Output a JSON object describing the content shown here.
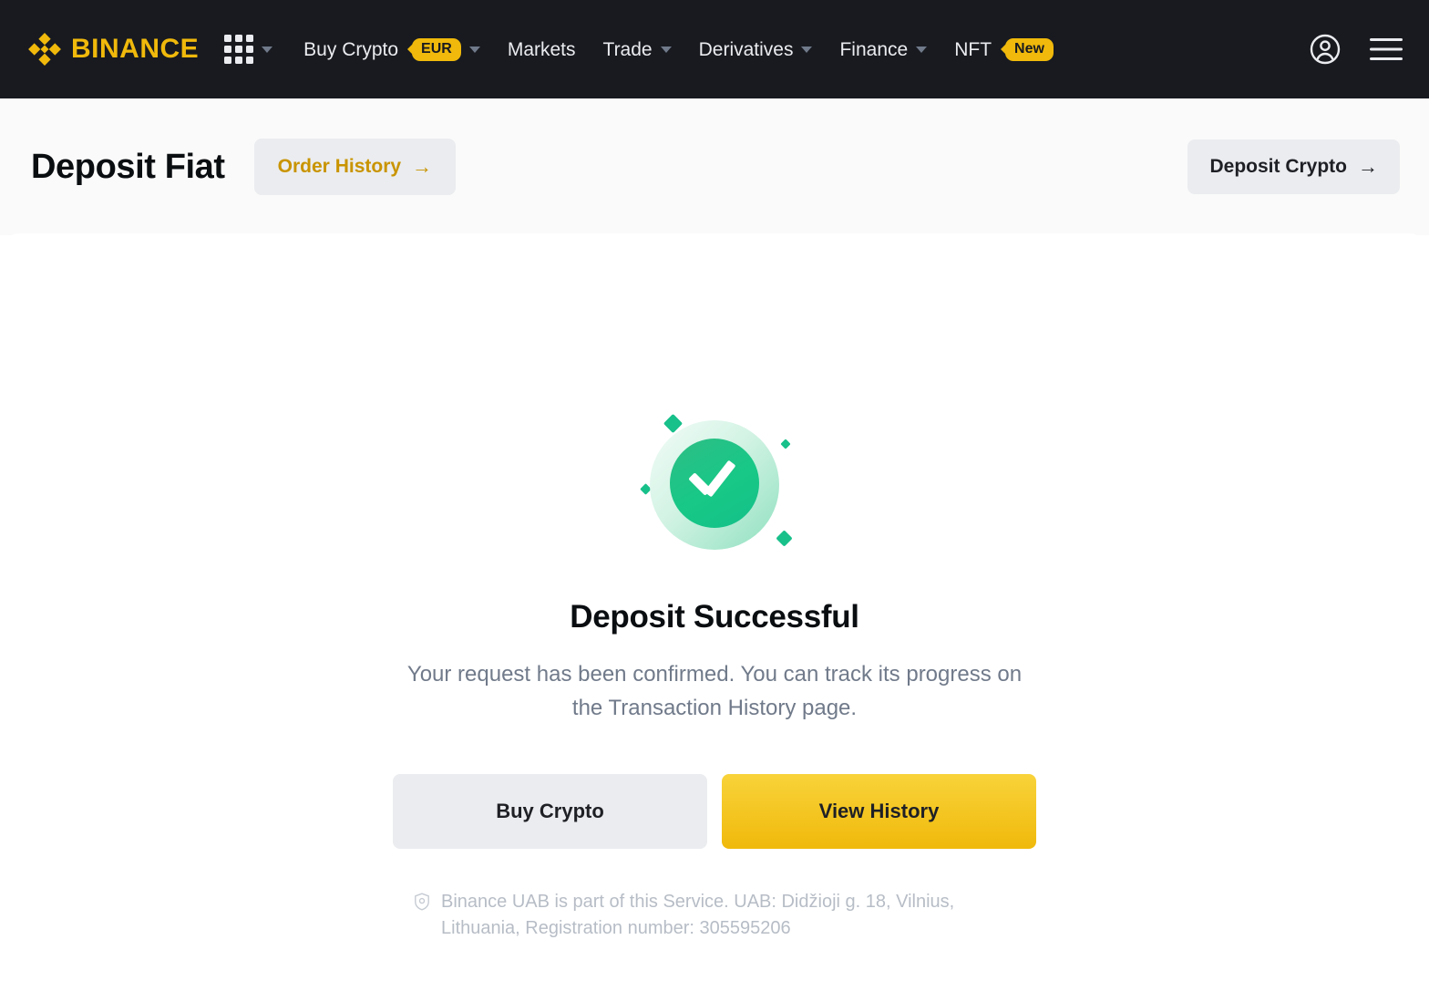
{
  "nav": {
    "brand": "BINANCE",
    "brand_color": "#F0B90B",
    "grid_icon": "grid-apps-icon",
    "items": [
      {
        "label": "Buy Crypto",
        "badge": "EUR",
        "caret": true
      },
      {
        "label": "Markets",
        "badge": null,
        "caret": false
      },
      {
        "label": "Trade",
        "badge": null,
        "caret": true
      },
      {
        "label": "Derivatives",
        "badge": null,
        "caret": true
      },
      {
        "label": "Finance",
        "badge": null,
        "caret": true
      },
      {
        "label": "NFT",
        "badge": "New",
        "caret": false
      }
    ],
    "profile_icon": "user-account-icon",
    "menu_icon": "hamburger-menu-icon"
  },
  "header": {
    "title": "Deposit Fiat",
    "order_history_label": "Order History",
    "order_history_arrow": "→",
    "order_history_color": "#C99400",
    "deposit_crypto_label": "Deposit Crypto",
    "deposit_crypto_arrow": "→"
  },
  "main": {
    "status_icon": "success-check-circle-icon",
    "status_color": "#17C886",
    "title": "Deposit Successful",
    "description": "Your request has been confirmed. You can track its progress on the Transaction History page.",
    "buttons": {
      "secondary_label": "Buy Crypto",
      "primary_label": "View History",
      "primary_color": "#F0B90B"
    },
    "legal": {
      "icon": "shield-check-icon",
      "text": "Binance UAB is part of this Service. UAB: Didžioji g. 18, Vilnius, Lithuania, Registration number: 305595206"
    }
  }
}
